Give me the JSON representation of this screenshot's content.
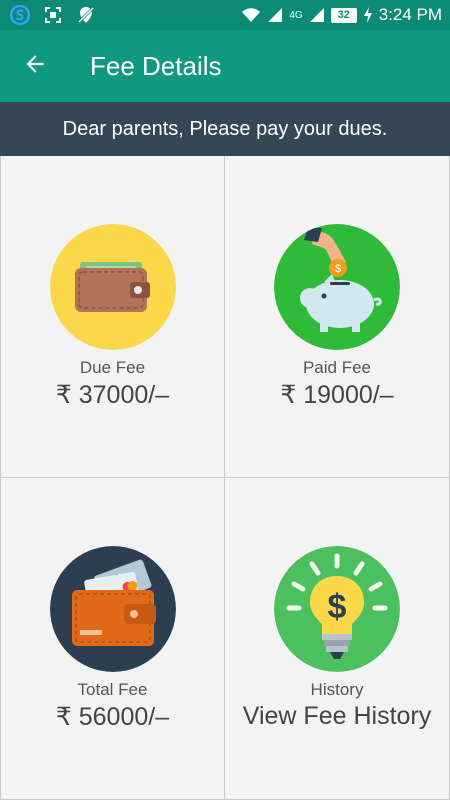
{
  "status_bar": {
    "time": "3:24 PM",
    "battery": "32",
    "network": "4G"
  },
  "app_bar": {
    "title": "Fee Details",
    "back_icon": "back-arrow-icon"
  },
  "notice": {
    "text": "Dear parents, Please pay your dues."
  },
  "tiles": [
    {
      "label": "Due Fee",
      "value": "₹ 37000/–",
      "icon": "wallet-icon",
      "icon_bg": "#fbd84a"
    },
    {
      "label": "Paid Fee",
      "value": "₹ 19000/–",
      "icon": "piggy-bank-icon",
      "icon_bg": "#2fba3a"
    },
    {
      "label": "Total Fee",
      "value": "₹ 56000/–",
      "icon": "wallet-cards-icon",
      "icon_bg": "#2d3e50"
    },
    {
      "label": "History",
      "value": "View Fee History",
      "icon": "lightbulb-dollar-icon",
      "icon_bg": "#4cbf5e"
    }
  ],
  "colors": {
    "status_bar": "#0b8a74",
    "app_bar": "#0f9a80",
    "notice_bar": "#374655"
  }
}
